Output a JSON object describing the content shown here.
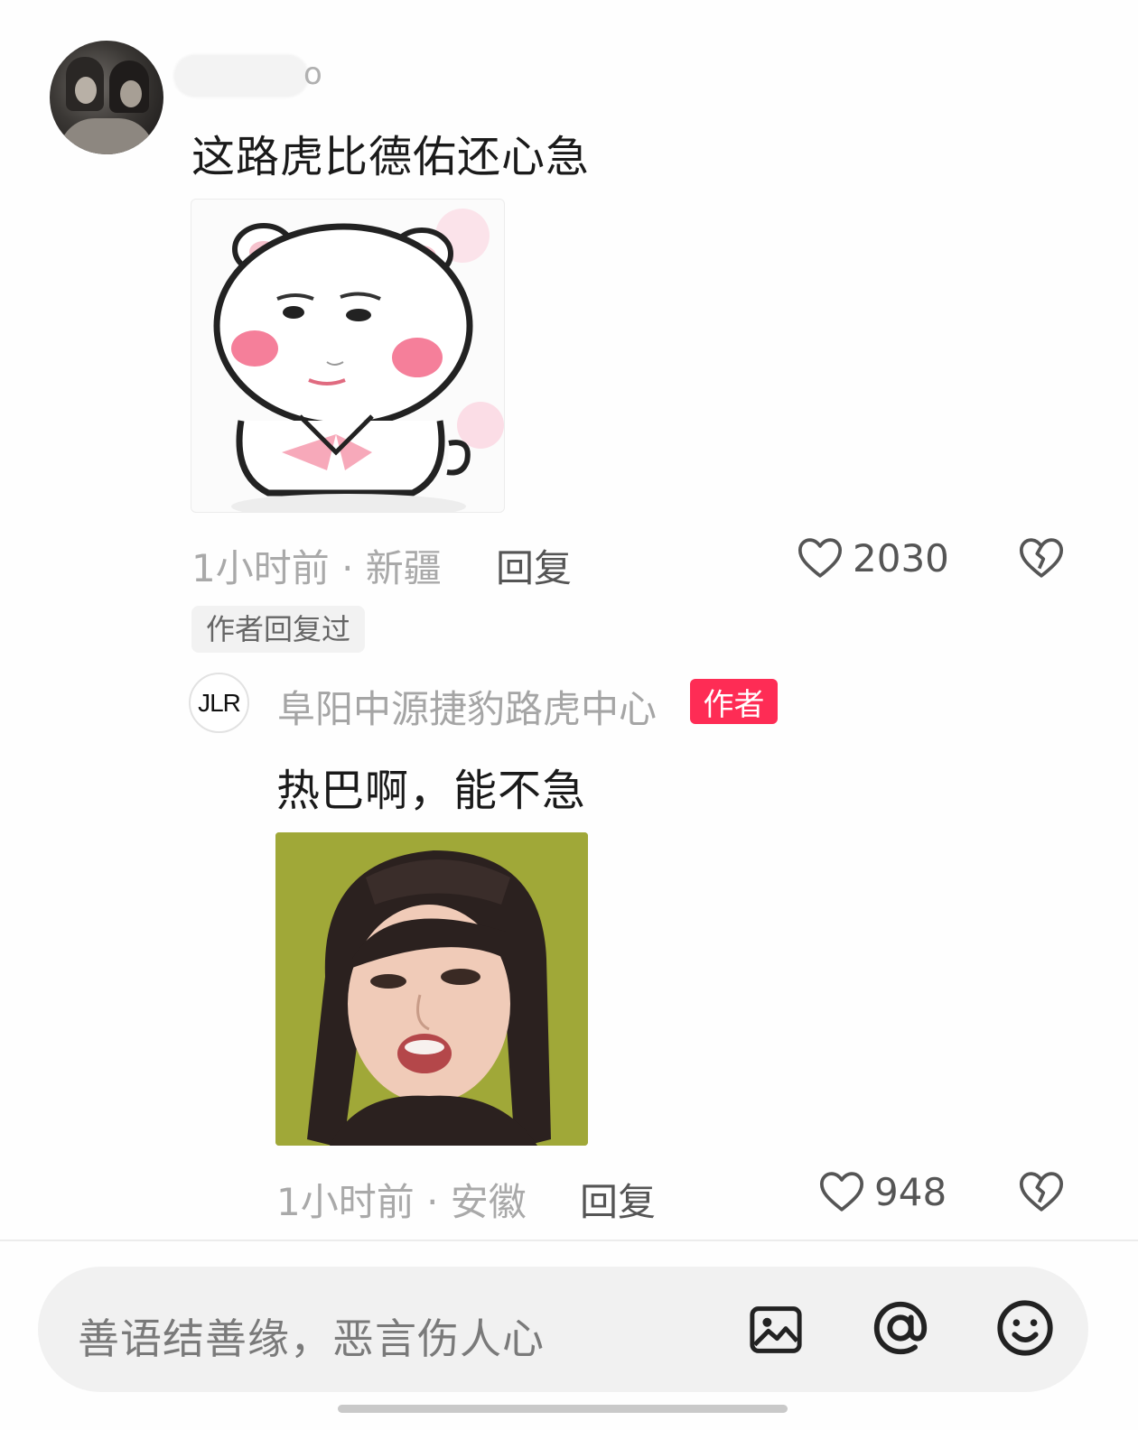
{
  "comment": {
    "username_suffix": "o",
    "text": "这路虎比德佑还心急",
    "time_location": "1小时前 · 新疆",
    "reply_label": "回复",
    "like_count": "2030",
    "author_replied_tag": "作者回复过"
  },
  "reply": {
    "avatar_text": "JLR",
    "username": "阜阳中源捷豹路虎中心",
    "author_badge": "作者",
    "text": "热巴啊，能不急",
    "time_location": "1小时前 · 安徽",
    "reply_label": "回复",
    "like_count": "948"
  },
  "input": {
    "placeholder": "善语结善缘，恶言伤人心"
  },
  "icons": {
    "image": "image-icon",
    "mention": "at-icon",
    "emoji": "emoji-icon",
    "like": "heart-icon",
    "dislike": "broken-heart-icon"
  },
  "colors": {
    "accent": "#fe2c55",
    "text_primary": "#1a1a1a",
    "text_secondary": "#a9a9a9"
  }
}
